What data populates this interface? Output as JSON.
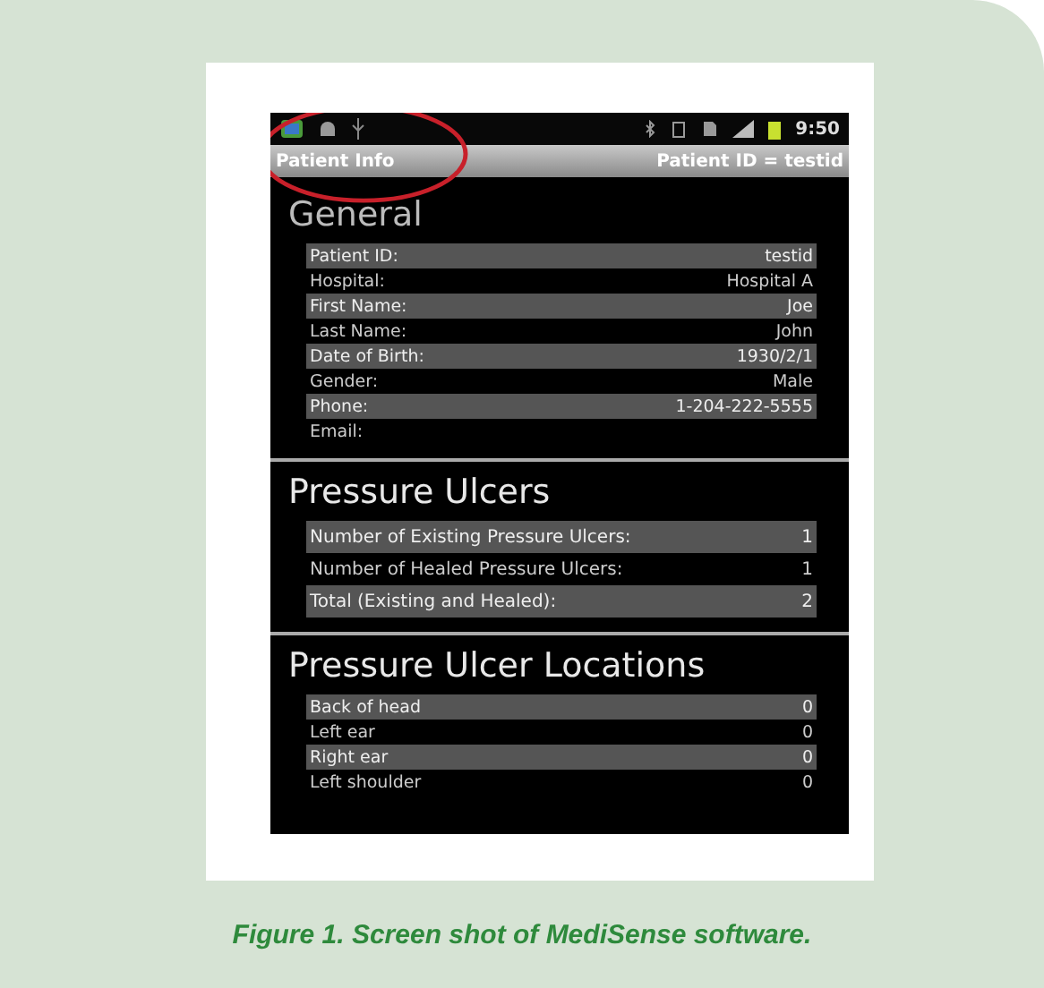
{
  "status_bar": {
    "time": "9:50"
  },
  "title_bar": {
    "title": "Patient Info",
    "patient_id": "Patient ID = testid"
  },
  "sections": [
    {
      "heading": "General",
      "rows": [
        {
          "label": "Patient ID:",
          "value": "testid"
        },
        {
          "label": "Hospital:",
          "value": "Hospital A"
        },
        {
          "label": "First Name:",
          "value": "Joe"
        },
        {
          "label": "Last Name:",
          "value": "John"
        },
        {
          "label": "Date of Birth:",
          "value": "1930/2/1"
        },
        {
          "label": "Gender:",
          "value": "Male"
        },
        {
          "label": "Phone:",
          "value": "1-204-222-5555"
        },
        {
          "label": "Email:"
        }
      ]
    },
    {
      "heading": "Pressure Ulcers",
      "rows": [
        {
          "label": "Number of Existing Pressure Ulcers:",
          "value": "1"
        },
        {
          "label": "Number of Healed Pressure Ulcers:",
          "value": "1"
        },
        {
          "label": "Total (Existing and Healed):",
          "value": "2"
        }
      ]
    },
    {
      "heading": "Pressure Ulcer Locations",
      "rows": [
        {
          "label": "Back of head",
          "value": "0"
        },
        {
          "label": "Left ear",
          "value": "0"
        },
        {
          "label": "Right ear",
          "value": "0"
        },
        {
          "label": "Left shoulder",
          "value": "0"
        }
      ]
    }
  ],
  "caption": "Figure 1. Screen shot of MediSense software."
}
